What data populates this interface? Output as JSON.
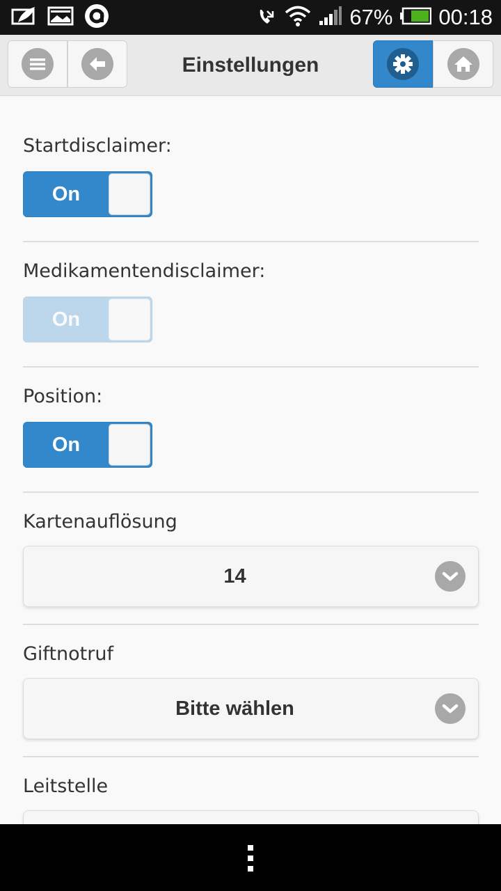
{
  "status_bar": {
    "battery_percent": "67%",
    "time": "00:18",
    "icons": [
      "image-icon",
      "photo-icon",
      "app-a-icon",
      "missed-call-icon",
      "wifi-icon",
      "signal-icon",
      "battery-icon"
    ]
  },
  "header": {
    "title": "Einstellungen",
    "buttons": [
      "menu-icon",
      "back-icon",
      "settings-icon",
      "home-icon"
    ],
    "accent_color": "#3388cc"
  },
  "settings": {
    "startdisclaimer": {
      "label": "Startdisclaimer:",
      "value": "On",
      "enabled": true
    },
    "medikamentendisclaimer": {
      "label": "Medikamentendisclaimer:",
      "value": "On",
      "enabled": false
    },
    "position": {
      "label": "Position:",
      "value": "On",
      "enabled": true
    },
    "kartenaufloesung": {
      "label": "Kartenauflösung",
      "value": "14"
    },
    "giftnotruf": {
      "label": "Giftnotruf",
      "value": "Bitte wählen"
    },
    "leitstelle": {
      "label": "Leitstelle"
    }
  },
  "nav_bar": {
    "icon": "overflow-menu-icon"
  }
}
